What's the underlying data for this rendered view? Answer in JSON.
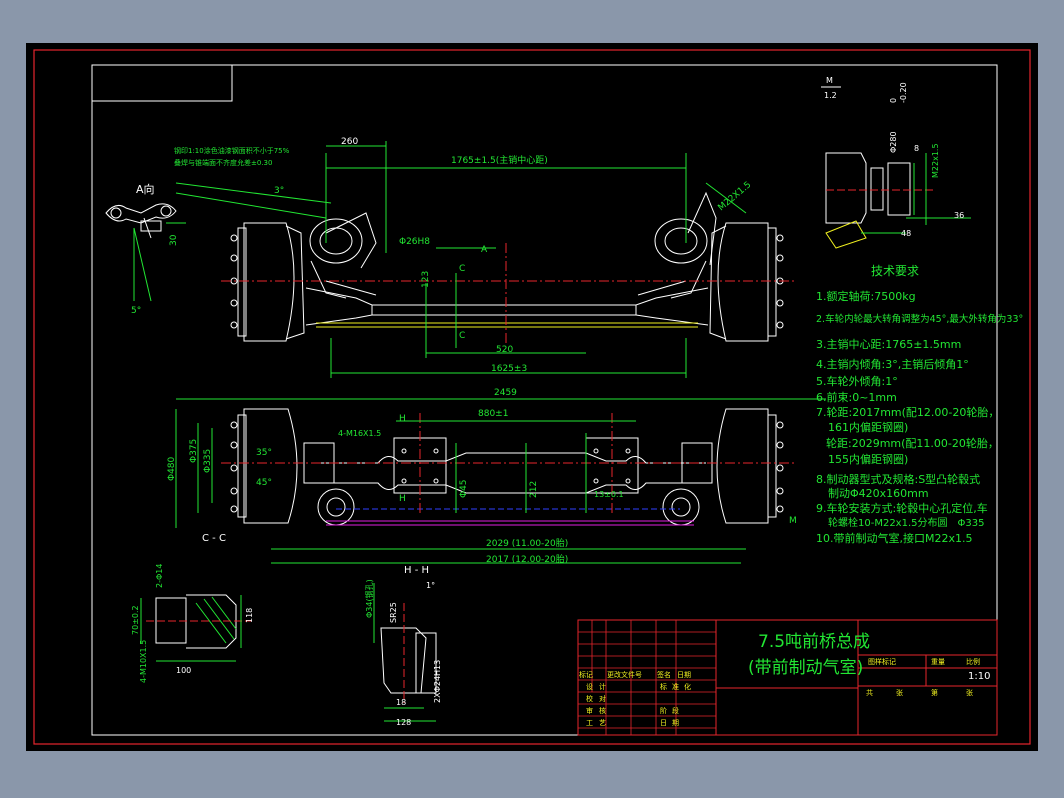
{
  "drawing": {
    "title_line1": "7.5吨前桥总成",
    "title_line2": "(带前制动气室)",
    "scale": "1:10"
  },
  "tech": {
    "heading": "技术要求",
    "items": [
      "1.额定轴荷:7500kg",
      "2.车轮内轮最大转角调整为45°,最大外转角为33°",
      "3.主销中心距:1765±1.5mm",
      "4.主销内倾角:3°,主销后倾角1°",
      "5.车轮外倾角:1°",
      "6.前束:0~1mm",
      "7.轮距:2017mm(配12.00-20轮胎，",
      "161内偏距钢圈)",
      "轮距:2029mm(配11.00-20轮胎，",
      "155内偏距钢圈)",
      "8.制动器型式及规格:S型凸轮毂式",
      "制动Φ420x160mm",
      "9.车轮安装方式:轮毂中心孔定位,车",
      "轮螺栓10-M22x1.5分布圆　Φ335",
      "10.带前制动气室,接口M22x1.5"
    ]
  },
  "notes": {
    "line1": "钢印1:10涂色油漆钢面积不小于75%",
    "line2": "叠焊与锥端面不齐度允差±0.30"
  },
  "views": {
    "a_view": "A向",
    "cc": "C - C",
    "hh": "H - H",
    "m": "M",
    "m_scale": "1.2"
  },
  "dims": {
    "d260": "260",
    "d1765": "1765±1.5(主销中心距)",
    "dm22": "M22X1.5",
    "d26h8": "Φ26H8",
    "d520": "520",
    "d1625": "1625±3",
    "d2459": "2459",
    "d880": "880±1",
    "dm16": "4-M16X1.5",
    "d480": "Φ480",
    "d375": "Φ375",
    "d335": "Φ335",
    "d45": "Φ45",
    "d212": "212",
    "d2029": "2029 (11.00-20胎)",
    "d2017": "2017 (12.00-20胎)",
    "d35": "35°",
    "d45deg": "45°",
    "d3": "3°",
    "d5": "5°",
    "d30": "30",
    "d123": "123",
    "d13": "13±0.1",
    "d100": "100",
    "d70": "70±0.2",
    "d118": "118",
    "d2phi14": "2-Φ14",
    "d4m10": "4-M10X1.5",
    "d34": "Φ34(钢孔)",
    "dsr25": "SR25",
    "d1deg": "1°",
    "d128": "128",
    "d18": "18",
    "d24": "2XΦ24H13",
    "d280": "Φ280",
    "d36": "36",
    "d48": "48",
    "dm22b": "M22x1.5",
    "d0": "0",
    "d020": "-0.20",
    "d8": "8"
  },
  "titleblock": {
    "r1": [
      "标记",
      "处数",
      "更改文件号",
      "签名",
      "日期"
    ],
    "r2": [
      "设",
      "计",
      "标",
      "准",
      "化"
    ],
    "r3": [
      "校",
      "对"
    ],
    "r4": [
      "审",
      "核",
      "阶",
      "段"
    ],
    "r5": [
      "工",
      "艺",
      "日",
      "期"
    ],
    "right": [
      "图样标记",
      "重量",
      "比例",
      "共",
      "张",
      "第",
      "张"
    ]
  },
  "colors": {
    "frame_red": "#e6262d",
    "line_white": "#ffffff",
    "dim_green": "#22e633",
    "accent_yellow": "#f0f020",
    "magenta": "#e020e0",
    "blue": "#3040ff"
  }
}
